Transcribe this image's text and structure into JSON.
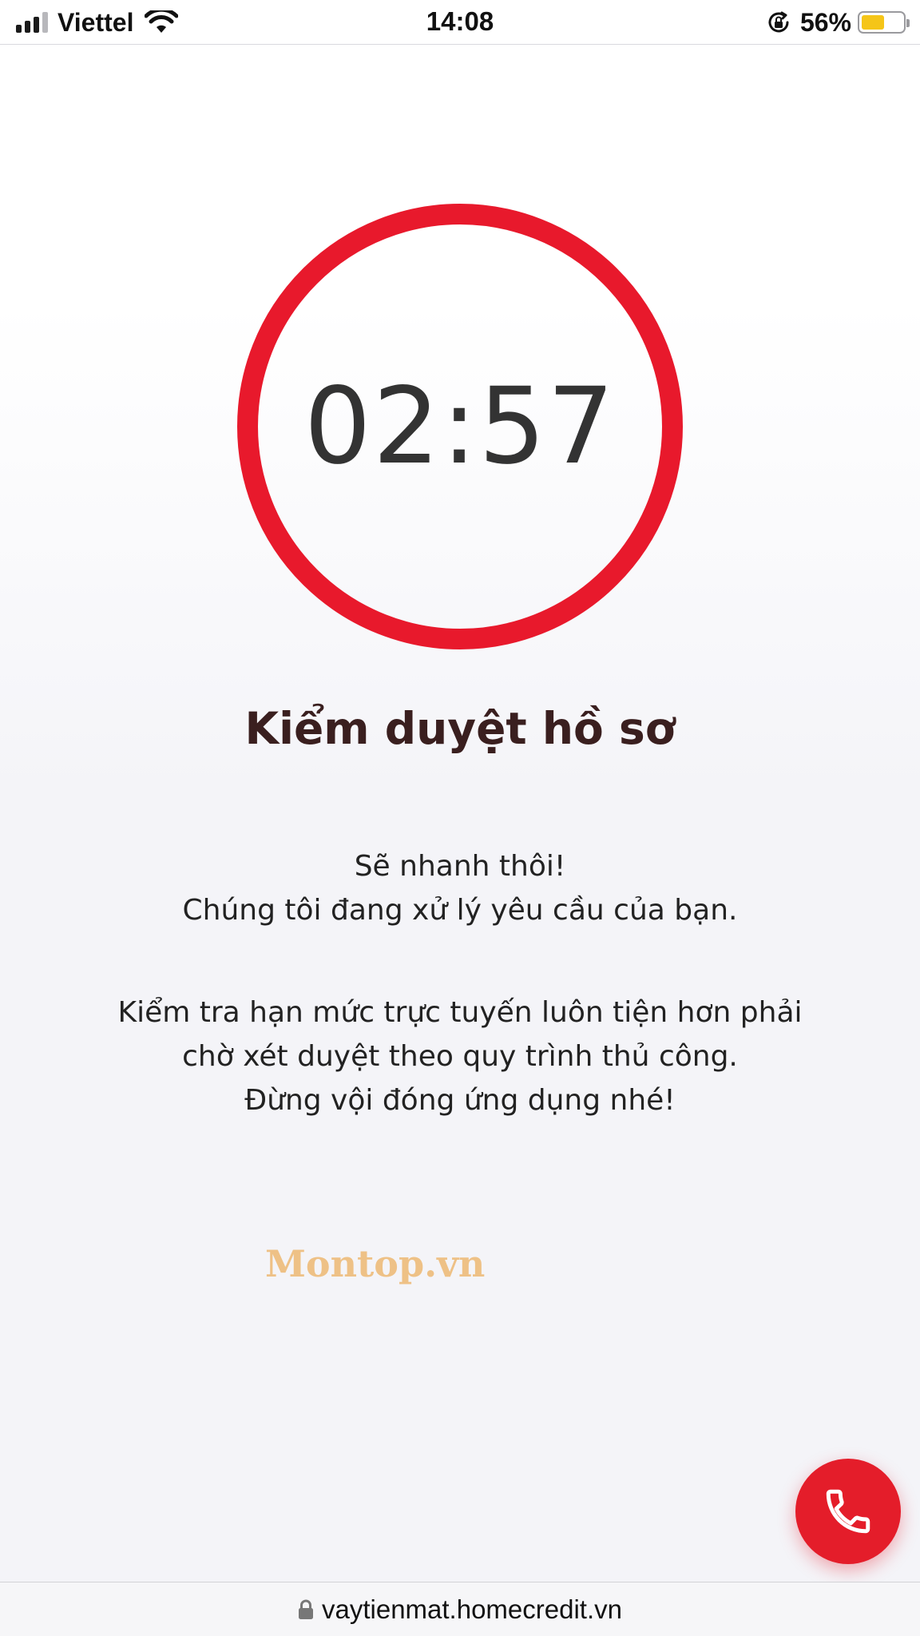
{
  "status_bar": {
    "carrier": "Viettel",
    "time": "14:08",
    "battery_percent": "56%",
    "battery_level": 0.56,
    "signal_bars_active": 3,
    "signal_bars_total": 4,
    "icons": [
      "signal-icon",
      "wifi-icon",
      "orientation-lock-icon",
      "battery-icon"
    ]
  },
  "timer": {
    "value": "02:57",
    "ring_color": "#e8192c"
  },
  "content": {
    "title": "Kiểm duyệt hồ sơ",
    "para1_line1": "Sẽ nhanh thôi!",
    "para1_line2": "Chúng tôi đang xử lý yêu cầu của bạn.",
    "para2_line1": "Kiểm tra hạn mức trực tuyến luôn tiện hơn phải",
    "para2_line2": "chờ xét duyệt theo quy trình thủ công.",
    "para2_line3": "Đừng vội đóng ứng dụng nhé!"
  },
  "watermark": "Montop.vn",
  "call_button": {
    "icon": "phone-icon",
    "color": "#e41d2a"
  },
  "address_bar": {
    "url": "vaytienmat.homecredit.vn",
    "icon": "padlock-icon"
  }
}
